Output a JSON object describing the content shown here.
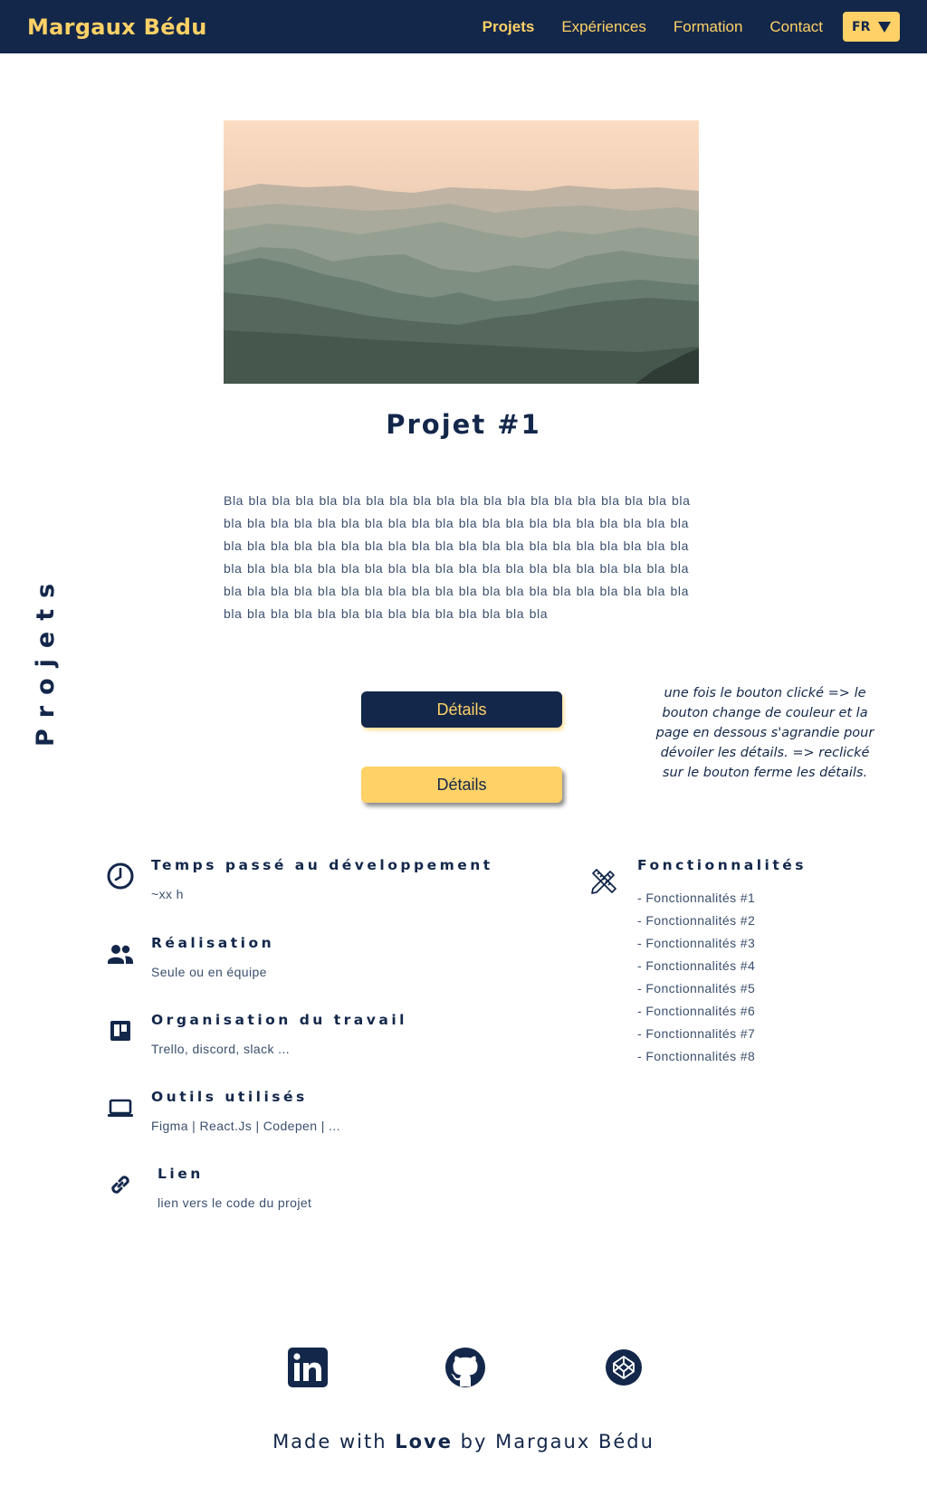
{
  "header": {
    "brand": "Margaux Bédu",
    "nav": [
      "Projets",
      "Expériences",
      "Formation",
      "Contact"
    ],
    "language": "FR"
  },
  "side_label": "Projets",
  "project": {
    "title": "Projet #1",
    "description": "Bla bla bla bla bla bla bla bla bla bla bla bla bla bla bla bla bla bla bla bla bla bla bla bla bla bla bla bla bla bla bla bla bla bla bla bla bla bla bla bla bla bla bla bla bla bla bla bla bla bla bla bla bla bla bla bla bla bla bla bla bla bla bla bla bla bla bla bla bla bla bla bla bla bla bla bla bla bla bla bla bla bla bla bla bla bla bla bla bla bla bla bla bla bla bla bla bla bla bla bla bla bla bla bla bla bla bla bla bla bla bla bla bla bla",
    "button_dark_label": "Détails",
    "button_light_label": "Détails",
    "note": "une fois le bouton clické => le bouton change de couleur et la page en dessous s'agrandie pour dévoiler les détails. => reclické sur le bouton ferme les détails."
  },
  "info": [
    {
      "icon": "clock-icon",
      "title": "Temps passé au développement",
      "text": "~xx h"
    },
    {
      "icon": "people-icon",
      "title": "Réalisation",
      "text": "Seule ou en équipe"
    },
    {
      "icon": "trello-icon",
      "title": "Organisation du travail",
      "text": "Trello, discord, slack ..."
    },
    {
      "icon": "laptop-icon",
      "title": "Outils utilisés",
      "text": "Figma | React.Js | Codepen | ..."
    },
    {
      "icon": "link-icon",
      "title": "Lien",
      "text": "lien vers le code du projet"
    }
  ],
  "features": {
    "icon": "pencil-ruler-icon",
    "title": "Fonctionnalités",
    "items": [
      "- Fonctionnalités #1",
      "- Fonctionnalités #2",
      "- Fonctionnalités #3",
      "- Fonctionnalités #4",
      "- Fonctionnalités #5",
      "- Fonctionnalités #6",
      "- Fonctionnalités #7",
      "- Fonctionnalités #8"
    ]
  },
  "socials": [
    "linkedin-icon",
    "github-icon",
    "codepen-icon"
  ],
  "footer": {
    "prefix": "Made with",
    "highlight": "Love",
    "suffix": "by Margaux Bédu"
  },
  "colors": {
    "navy": "#13274a",
    "yellow": "#ffd166",
    "text": "#3b4f6e"
  }
}
